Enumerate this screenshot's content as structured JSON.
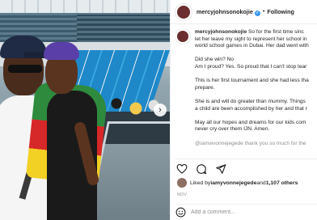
{
  "header": {
    "username": "mercyjohnsonokojie",
    "separator": "•",
    "follow_label": "Following"
  },
  "caption": {
    "username": "mercyjohnsonokojie",
    "lines": [
      "So for the first time sinc",
      "let her leave my sight to represent her school in",
      "world school games in Dubai. Her dad went with"
    ],
    "paragraphs": [
      [
        "Did she win? No",
        "Am I proud? Yes. So proud that I can't stop tear"
      ],
      [
        "This is her first tournament and she had less tha",
        "prepare."
      ],
      [
        "She is and will do greater than mummy. Things",
        "a child are been accomplished by her and that r"
      ],
      [
        "May all our hopes and dreams for our kids com",
        "never cry over them IJN. Amen."
      ]
    ],
    "faded_line": "@iamwvonnejegede thank you so much for the"
  },
  "actions": {
    "like_icon": "heart-icon",
    "comment_icon": "comment-icon",
    "share_icon": "send-icon"
  },
  "likes": {
    "prefix": "Liked by ",
    "user": "iamyvonnejegede",
    "middle": " and ",
    "count": "1,107 others"
  },
  "date": "NOV",
  "comment": {
    "placeholder": "Add a comment..."
  },
  "photo": {
    "next_icon": "chevron-right-icon",
    "chevron_glyph": "›"
  }
}
